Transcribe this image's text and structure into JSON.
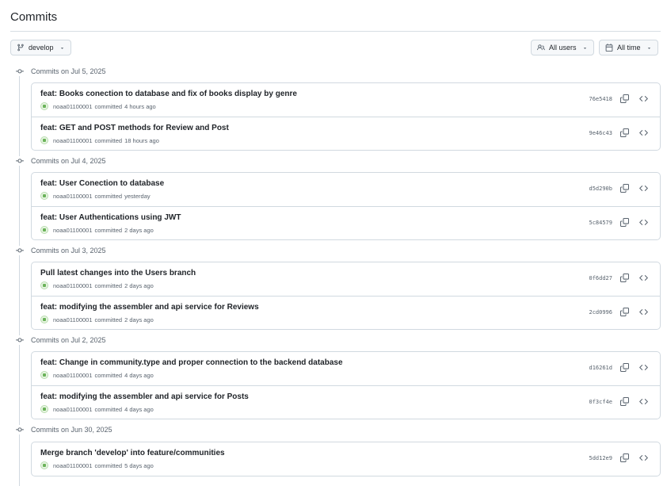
{
  "page": {
    "title": "Commits"
  },
  "toolbar": {
    "branch_label": "develop",
    "users_label": "All users",
    "time_label": "All time"
  },
  "groups": [
    {
      "date_label": "Commits on Jul 5, 2025",
      "commits": [
        {
          "message": "feat: Books conection to database and fix of books display by genre",
          "author": "noaa01100001",
          "action": "committed",
          "when": "4 hours ago",
          "sha": "76e5418"
        },
        {
          "message": "feat: GET and POST methods for Review and Post",
          "author": "noaa01100001",
          "action": "committed",
          "when": "18 hours ago",
          "sha": "9e46c43"
        }
      ]
    },
    {
      "date_label": "Commits on Jul 4, 2025",
      "commits": [
        {
          "message": "feat: User Conection to database",
          "author": "noaa01100001",
          "action": "committed",
          "when": "yesterday",
          "sha": "d5d290b"
        },
        {
          "message": "feat: User Authentications using JWT",
          "author": "noaa01100001",
          "action": "committed",
          "when": "2 days ago",
          "sha": "5c84579"
        }
      ]
    },
    {
      "date_label": "Commits on Jul 3, 2025",
      "commits": [
        {
          "message": "Pull latest changes into the Users branch",
          "author": "noaa01100001",
          "action": "committed",
          "when": "2 days ago",
          "sha": "0f6dd27"
        },
        {
          "message": "feat: modifying the assembler and api service for Reviews",
          "author": "noaa01100001",
          "action": "committed",
          "when": "2 days ago",
          "sha": "2cd0996"
        }
      ]
    },
    {
      "date_label": "Commits on Jul 2, 2025",
      "commits": [
        {
          "message": "feat: Change in community.type and proper connection to the backend database",
          "author": "noaa01100001",
          "action": "committed",
          "when": "4 days ago",
          "sha": "d16261d"
        },
        {
          "message": "feat: modifying the assembler and api service for Posts",
          "author": "noaa01100001",
          "action": "committed",
          "when": "4 days ago",
          "sha": "0f3cf4e"
        }
      ]
    },
    {
      "date_label": "Commits on Jun 30, 2025",
      "commits": [
        {
          "message": "Merge branch 'develop' into feature/communities",
          "author": "noaa01100001",
          "action": "committed",
          "when": "5 days ago",
          "sha": "5dd12e9"
        }
      ]
    }
  ],
  "icons": {
    "branch": "git-branch-icon",
    "users": "people-icon",
    "calendar": "calendar-icon",
    "commit": "git-commit-icon",
    "copy": "copy-icon",
    "browse": "code-icon",
    "caret": "triangle-down-icon"
  },
  "colors": {
    "border": "#d1d9e0",
    "text": "#1f2328",
    "muted": "#59636e",
    "button_bg": "#f6f8fa"
  }
}
